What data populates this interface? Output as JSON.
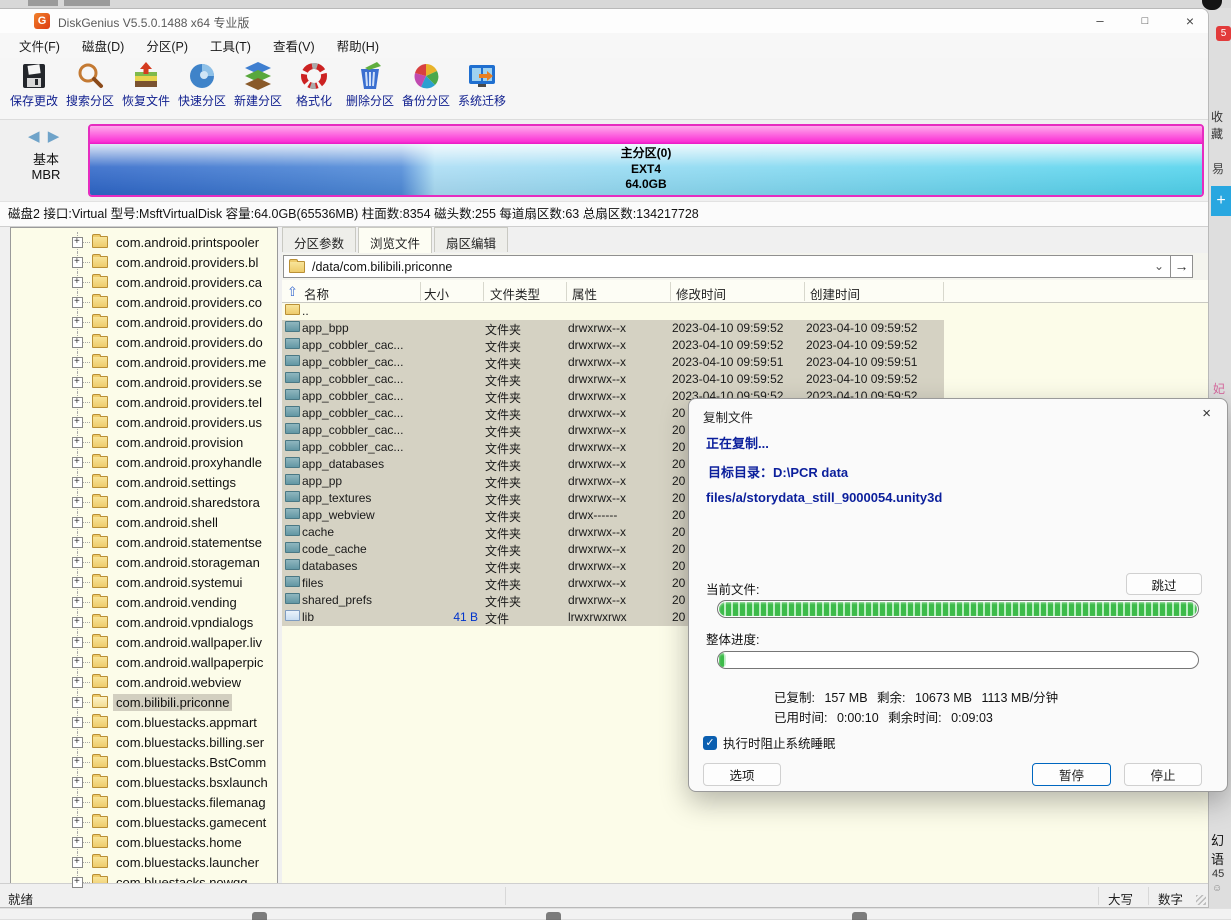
{
  "window": {
    "title": "DiskGenius V5.5.0.1488 x64 专业版",
    "minimize": "–",
    "maximize": "□",
    "close": "×",
    "app_badge": "G"
  },
  "menu": {
    "items": [
      "文件(F)",
      "磁盘(D)",
      "分区(P)",
      "工具(T)",
      "查看(V)",
      "帮助(H)"
    ]
  },
  "toolbar": {
    "buttons": [
      {
        "icon": "save-icon",
        "label": "保存更改"
      },
      {
        "icon": "search-partition-icon",
        "label": "搜索分区"
      },
      {
        "icon": "recover-files-icon",
        "label": "恢复文件"
      },
      {
        "icon": "quick-partition-icon",
        "label": "快速分区"
      },
      {
        "icon": "new-partition-icon",
        "label": "新建分区"
      },
      {
        "icon": "format-icon",
        "label": "格式化"
      },
      {
        "icon": "delete-partition-icon",
        "label": "删除分区"
      },
      {
        "icon": "backup-partition-icon",
        "label": "备份分区"
      },
      {
        "icon": "system-migrate-icon",
        "label": "系统迁移"
      }
    ]
  },
  "partition": {
    "nav_icons": "◀ ▶",
    "group": "基本",
    "scheme": "MBR",
    "title": "主分区(0)",
    "fs": "EXT4",
    "size": "64.0GB"
  },
  "disk_info": {
    "text": "磁盘2 接口:Virtual  型号:MsftVirtualDisk  容量:64.0GB(65536MB)  柱面数:8354  磁头数:255  每道扇区数:63  总扇区数:134217728"
  },
  "tree": {
    "items": [
      {
        "label": "com.android.printspooler"
      },
      {
        "label": "com.android.providers.bl"
      },
      {
        "label": "com.android.providers.ca"
      },
      {
        "label": "com.android.providers.co"
      },
      {
        "label": "com.android.providers.do"
      },
      {
        "label": "com.android.providers.do"
      },
      {
        "label": "com.android.providers.me"
      },
      {
        "label": "com.android.providers.se"
      },
      {
        "label": "com.android.providers.tel"
      },
      {
        "label": "com.android.providers.us"
      },
      {
        "label": "com.android.provision"
      },
      {
        "label": "com.android.proxyhandle"
      },
      {
        "label": "com.android.settings"
      },
      {
        "label": "com.android.sharedstora"
      },
      {
        "label": "com.android.shell"
      },
      {
        "label": "com.android.statementse"
      },
      {
        "label": "com.android.storageman"
      },
      {
        "label": "com.android.systemui"
      },
      {
        "label": "com.android.vending"
      },
      {
        "label": "com.android.vpndialogs"
      },
      {
        "label": "com.android.wallpaper.liv"
      },
      {
        "label": "com.android.wallpaperpic"
      },
      {
        "label": "com.android.webview"
      },
      {
        "label": "com.bilibili.priconne",
        "cls": "sel"
      },
      {
        "label": "com.bluestacks.appmart"
      },
      {
        "label": "com.bluestacks.billing.ser"
      },
      {
        "label": "com.bluestacks.BstComm"
      },
      {
        "label": "com.bluestacks.bsxlaunch"
      },
      {
        "label": "com.bluestacks.filemanag"
      },
      {
        "label": "com.bluestacks.gamecent"
      },
      {
        "label": "com.bluestacks.home"
      },
      {
        "label": "com.bluestacks.launcher"
      },
      {
        "label": "com.bluestacks.nowgg"
      }
    ]
  },
  "tabs": {
    "items": [
      "分区参数",
      "浏览文件",
      "扇区编辑"
    ],
    "active": "浏览文件"
  },
  "path": {
    "value": "/data/com.bilibili.priconne",
    "chevron": "⌄",
    "go": "→"
  },
  "table": {
    "sort_icon": "⇧",
    "headers": [
      "名称",
      "大小",
      "文件类型",
      "属性",
      "修改时间",
      "创建时间"
    ],
    "rows": [
      {
        "cls": "up",
        "name": "..",
        "size": "",
        "type": "",
        "attr": "",
        "mtime": "",
        "ctime": ""
      },
      {
        "cls": "sel",
        "name": "app_bpp",
        "size": "",
        "type": "文件夹",
        "attr": "drwxrwx--x",
        "mtime": "2023-04-10 09:59:52",
        "ctime": "2023-04-10 09:59:52"
      },
      {
        "cls": "sel",
        "name": "app_cobbler_cac...",
        "size": "",
        "type": "文件夹",
        "attr": "drwxrwx--x",
        "mtime": "2023-04-10 09:59:52",
        "ctime": "2023-04-10 09:59:52"
      },
      {
        "cls": "sel",
        "name": "app_cobbler_cac...",
        "size": "",
        "type": "文件夹",
        "attr": "drwxrwx--x",
        "mtime": "2023-04-10 09:59:51",
        "ctime": "2023-04-10 09:59:51"
      },
      {
        "cls": "sel",
        "name": "app_cobbler_cac...",
        "size": "",
        "type": "文件夹",
        "attr": "drwxrwx--x",
        "mtime": "2023-04-10 09:59:52",
        "ctime": "2023-04-10 09:59:52"
      },
      {
        "cls": "sel",
        "name": "app_cobbler_cac...",
        "size": "",
        "type": "文件夹",
        "attr": "drwxrwx--x",
        "mtime": "2023-04-10 09:59:52",
        "ctime": "2023-04-10 09:59:52"
      },
      {
        "cls": "sel",
        "name": "app_cobbler_cac...",
        "size": "",
        "type": "文件夹",
        "attr": "drwxrwx--x",
        "mtime": "20",
        "ctime": ""
      },
      {
        "cls": "sel",
        "name": "app_cobbler_cac...",
        "size": "",
        "type": "文件夹",
        "attr": "drwxrwx--x",
        "mtime": "20",
        "ctime": ""
      },
      {
        "cls": "sel",
        "name": "app_cobbler_cac...",
        "size": "",
        "type": "文件夹",
        "attr": "drwxrwx--x",
        "mtime": "20",
        "ctime": ""
      },
      {
        "cls": "sel",
        "name": "app_databases",
        "size": "",
        "type": "文件夹",
        "attr": "drwxrwx--x",
        "mtime": "20",
        "ctime": ""
      },
      {
        "cls": "sel",
        "name": "app_pp",
        "size": "",
        "type": "文件夹",
        "attr": "drwxrwx--x",
        "mtime": "20",
        "ctime": ""
      },
      {
        "cls": "sel",
        "name": "app_textures",
        "size": "",
        "type": "文件夹",
        "attr": "drwxrwx--x",
        "mtime": "20",
        "ctime": ""
      },
      {
        "cls": "sel",
        "name": "app_webview",
        "size": "",
        "type": "文件夹",
        "attr": "drwx------",
        "mtime": "20",
        "ctime": ""
      },
      {
        "cls": "sel",
        "name": "cache",
        "size": "",
        "type": "文件夹",
        "attr": "drwxrwx--x",
        "mtime": "20",
        "ctime": ""
      },
      {
        "cls": "sel",
        "name": "code_cache",
        "size": "",
        "type": "文件夹",
        "attr": "drwxrwx--x",
        "mtime": "20",
        "ctime": ""
      },
      {
        "cls": "sel",
        "name": "databases",
        "size": "",
        "type": "文件夹",
        "attr": "drwxrwx--x",
        "mtime": "20",
        "ctime": ""
      },
      {
        "cls": "sel",
        "name": "files",
        "size": "",
        "type": "文件夹",
        "attr": "drwxrwx--x",
        "mtime": "20",
        "ctime": ""
      },
      {
        "cls": "sel",
        "name": "shared_prefs",
        "size": "",
        "type": "文件夹",
        "attr": "drwxrwx--x",
        "mtime": "20",
        "ctime": ""
      },
      {
        "cls": "file sel",
        "name": "lib",
        "size": "41 B",
        "type": "文件",
        "attr": "lrwxrwxrwx",
        "mtime": "20",
        "ctime": ""
      }
    ]
  },
  "dialog": {
    "title": "复制文件",
    "close": "×",
    "status": "正在复制...",
    "dest_label": "目标目录：",
    "dest": "D:\\PCR data",
    "current_file_path": "files/a/storydata_still_9000054.unity3d",
    "current_label": "当前文件:",
    "skip": "跳过",
    "overall_label": "整体进度:",
    "current_pct": 100,
    "overall_pct": 1.5,
    "copied_label": "已复制:",
    "copied": "157 MB",
    "remain_label": "剩余:",
    "remain": "10673 MB",
    "speed": "1113 MB/分钟",
    "elapsed_label": "已用时间:",
    "elapsed": "0:00:10",
    "eta_label": "剩余时间:",
    "eta": "0:09:03",
    "checkbox_label": "执行时阻止系统睡眠",
    "checkbox_checked": true,
    "check_glyph": "✓",
    "options": "选项",
    "pause": "暂停",
    "stop": "停止"
  },
  "statusbar": {
    "ready": "就绪",
    "caps": "大写",
    "num": "数字"
  },
  "collapse_glyph": "▲",
  "peek": {
    "badge": "5",
    "bookmark": "收藏",
    "cloud": "易",
    "plus": "+",
    "fei": "妃",
    "c1": "幻",
    "c2": "语",
    "c3": "45",
    "face": "☺"
  }
}
